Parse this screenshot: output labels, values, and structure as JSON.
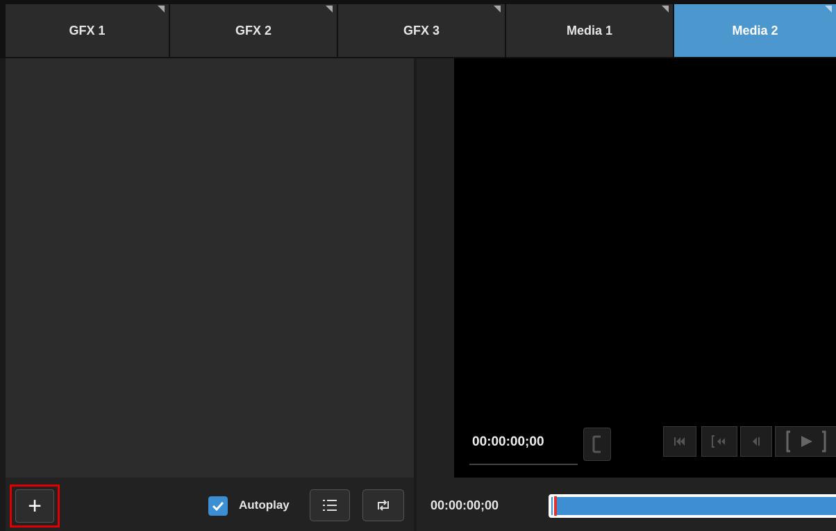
{
  "tabs": [
    {
      "label": "GFX 1",
      "active": false
    },
    {
      "label": "GFX 2",
      "active": false
    },
    {
      "label": "GFX 3",
      "active": false
    },
    {
      "label": "Media 1",
      "active": false
    },
    {
      "label": "Media 2",
      "active": true
    }
  ],
  "preview": {
    "timecode": "00:00:00;00"
  },
  "transport": {
    "icons": [
      "skip-to-start-icon",
      "rewind-icon",
      "step-back-icon",
      "play-icon"
    ]
  },
  "bottom": {
    "add_label": "+",
    "autoplay_label": "Autoplay",
    "autoplay_checked": true,
    "timecode": "00:00:00;00",
    "playlist_icon": "list-icon",
    "loop_icon": "loop-icon"
  },
  "colors": {
    "accent": "#4d97cf",
    "highlight_box": "#e00000",
    "progress": "#3d8ed3"
  }
}
